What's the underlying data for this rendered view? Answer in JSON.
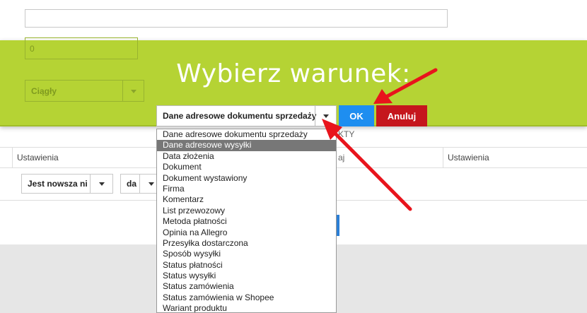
{
  "background": {
    "faint_input_value": "0",
    "faint_select_value": "Ciągły",
    "faded_text": "KTY",
    "faded_text2": "aj",
    "table_headers": [
      "Ustawienia",
      "Ustawienia"
    ],
    "row_select_1": "Jest nowsza ni",
    "row_select_2": "da"
  },
  "modal": {
    "title": "Wybierz warunek:",
    "selected_condition": "Dane adresowe dokumentu sprzedaży",
    "ok_label": "OK",
    "cancel_label": "Anuluj",
    "dropdown_options": [
      "Dane adresowe dokumentu sprzedaży",
      "Dane adresowe wysyłki",
      "Data złożenia",
      "Dokument",
      "Dokument wystawiony",
      "Firma",
      "Komentarz",
      "List przewozowy",
      "Metoda płatności",
      "Opinia na Allegro",
      "Przesyłka dostarczona",
      "Sposób wysyłki",
      "Status płatności",
      "Status wysyłki",
      "Status zamówienia",
      "Status zamówienia w Shopee",
      "Wariant produktu"
    ],
    "highlighted_index": 1
  },
  "colors": {
    "green_band": "#b5d334",
    "ok_blue": "#1e8ef0",
    "cancel_red": "#c5161d",
    "arrow_red": "#e8141c"
  },
  "icons": {
    "caret": "chevron-down-icon",
    "annotation": "red-arrow-icon"
  }
}
